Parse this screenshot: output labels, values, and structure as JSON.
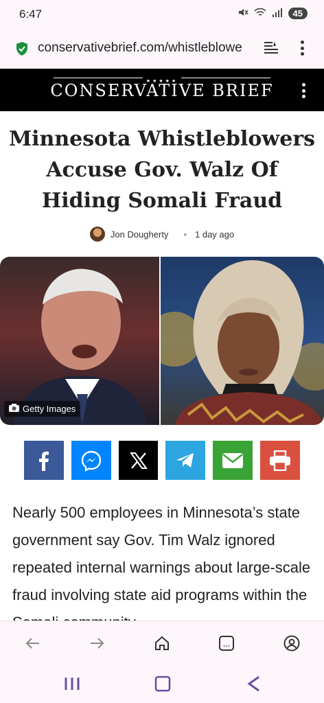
{
  "status": {
    "time": "6:47",
    "battery": "45"
  },
  "browser": {
    "url": "conservativebrief.com/whistleblowe"
  },
  "site": {
    "logo": "CONSERVATIVE BRIEF"
  },
  "article": {
    "headline": "Minnesota Whistleblowers Accuse Gov. Walz Of Hiding Somali Fraud",
    "author": "Jon Dougherty",
    "time_ago": "1 day ago",
    "image_credit": "Getty Images",
    "body": "Nearly 500 employees in Minnesota’s state government say Gov. Tim Walz ignored repeated internal warnings about large-scale fraud involving state aid programs within the Somali community"
  },
  "share_buttons": [
    {
      "name": "facebook",
      "color": "#3b5998",
      "icon": "facebook-icon"
    },
    {
      "name": "messenger",
      "color": "#0084ff",
      "icon": "messenger-icon"
    },
    {
      "name": "x",
      "color": "#000000",
      "icon": "x-icon"
    },
    {
      "name": "telegram",
      "color": "#2ca5e0",
      "icon": "telegram-icon"
    },
    {
      "name": "email",
      "color": "#3aa335",
      "icon": "email-icon"
    },
    {
      "name": "print",
      "color": "#d9503f",
      "icon": "print-icon"
    }
  ],
  "bottom_nav": [
    "back-icon",
    "forward-icon",
    "home-icon",
    "tabs-icon",
    "account-icon"
  ],
  "system_nav": [
    "recents-icon",
    "home-button-icon",
    "back-button-icon"
  ]
}
